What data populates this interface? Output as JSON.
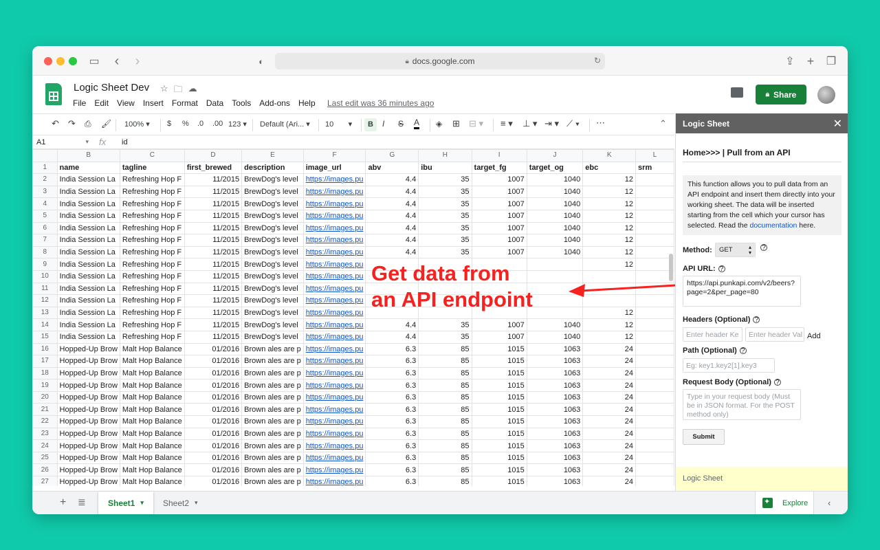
{
  "browser": {
    "url": "docs.google.com"
  },
  "doc": {
    "title": "Logic Sheet Dev",
    "menu": [
      "File",
      "Edit",
      "View",
      "Insert",
      "Format",
      "Data",
      "Tools",
      "Add-ons",
      "Help"
    ],
    "last_edit": "Last edit was 36 minutes ago",
    "share_label": "Share"
  },
  "toolbar": {
    "zoom": "100%",
    "currency": "$",
    "percent": "%",
    "dec_less": ".0",
    "dec_more": ".00",
    "number_format": "123",
    "font": "Default (Ari...",
    "font_size": "10",
    "bold": "B",
    "italic": "I",
    "strike": "S",
    "text_color": "A",
    "more": "⋯"
  },
  "formula_bar": {
    "cell_ref": "A1",
    "fx": "fx",
    "value": "id"
  },
  "grid": {
    "columns": [
      "B",
      "C",
      "D",
      "E",
      "F",
      "G",
      "H",
      "I",
      "J",
      "K",
      "L"
    ],
    "headers": [
      "name",
      "tagline",
      "first_brewed",
      "description",
      "image_url",
      "abv",
      "ibu",
      "target_fg",
      "target_og",
      "ebc",
      "srm"
    ],
    "rows": [
      [
        "2",
        "India Session La",
        "Refreshing Hop F",
        "11/2015",
        "BrewDog's level",
        "https://images.pu",
        "4.4",
        "35",
        "1007",
        "1040",
        "12",
        ""
      ],
      [
        "3",
        "India Session La",
        "Refreshing Hop F",
        "11/2015",
        "BrewDog's level",
        "https://images.pu",
        "4.4",
        "35",
        "1007",
        "1040",
        "12",
        ""
      ],
      [
        "4",
        "India Session La",
        "Refreshing Hop F",
        "11/2015",
        "BrewDog's level",
        "https://images.pu",
        "4.4",
        "35",
        "1007",
        "1040",
        "12",
        ""
      ],
      [
        "5",
        "India Session La",
        "Refreshing Hop F",
        "11/2015",
        "BrewDog's level",
        "https://images.pu",
        "4.4",
        "35",
        "1007",
        "1040",
        "12",
        ""
      ],
      [
        "6",
        "India Session La",
        "Refreshing Hop F",
        "11/2015",
        "BrewDog's level",
        "https://images.pu",
        "4.4",
        "35",
        "1007",
        "1040",
        "12",
        ""
      ],
      [
        "7",
        "India Session La",
        "Refreshing Hop F",
        "11/2015",
        "BrewDog's level",
        "https://images.pu",
        "4.4",
        "35",
        "1007",
        "1040",
        "12",
        ""
      ],
      [
        "8",
        "India Session La",
        "Refreshing Hop F",
        "11/2015",
        "BrewDog's level",
        "https://images.pu",
        "4.4",
        "35",
        "1007",
        "1040",
        "12",
        ""
      ],
      [
        "9",
        "India Session La",
        "Refreshing Hop F",
        "11/2015",
        "BrewDog's level",
        "https://images.pu",
        "",
        "",
        "",
        "",
        "12",
        ""
      ],
      [
        "10",
        "India Session La",
        "Refreshing Hop F",
        "11/2015",
        "BrewDog's level",
        "https://images.pu",
        "",
        "",
        "",
        "",
        "",
        ""
      ],
      [
        "11",
        "India Session La",
        "Refreshing Hop F",
        "11/2015",
        "BrewDog's level",
        "https://images.pu",
        "",
        "",
        "",
        "",
        "",
        ""
      ],
      [
        "12",
        "India Session La",
        "Refreshing Hop F",
        "11/2015",
        "BrewDog's level",
        "https://images.pu",
        "",
        "",
        "",
        "",
        "",
        ""
      ],
      [
        "13",
        "India Session La",
        "Refreshing Hop F",
        "11/2015",
        "BrewDog's level",
        "https://images.pu",
        "",
        "",
        "",
        "",
        "12",
        ""
      ],
      [
        "14",
        "India Session La",
        "Refreshing Hop F",
        "11/2015",
        "BrewDog's level",
        "https://images.pu",
        "4.4",
        "35",
        "1007",
        "1040",
        "12",
        ""
      ],
      [
        "15",
        "India Session La",
        "Refreshing Hop F",
        "11/2015",
        "BrewDog's level",
        "https://images.pu",
        "4.4",
        "35",
        "1007",
        "1040",
        "12",
        ""
      ],
      [
        "16",
        "Hopped-Up Brow",
        "Malt Hop Balance",
        "01/2016",
        "Brown ales are p",
        "https://images.pu",
        "6.3",
        "85",
        "1015",
        "1063",
        "24",
        ""
      ],
      [
        "17",
        "Hopped-Up Brow",
        "Malt Hop Balance",
        "01/2016",
        "Brown ales are p",
        "https://images.pu",
        "6.3",
        "85",
        "1015",
        "1063",
        "24",
        ""
      ],
      [
        "18",
        "Hopped-Up Brow",
        "Malt Hop Balance",
        "01/2016",
        "Brown ales are p",
        "https://images.pu",
        "6.3",
        "85",
        "1015",
        "1063",
        "24",
        ""
      ],
      [
        "19",
        "Hopped-Up Brow",
        "Malt Hop Balance",
        "01/2016",
        "Brown ales are p",
        "https://images.pu",
        "6.3",
        "85",
        "1015",
        "1063",
        "24",
        ""
      ],
      [
        "20",
        "Hopped-Up Brow",
        "Malt Hop Balance",
        "01/2016",
        "Brown ales are p",
        "https://images.pu",
        "6.3",
        "85",
        "1015",
        "1063",
        "24",
        ""
      ],
      [
        "21",
        "Hopped-Up Brow",
        "Malt Hop Balance",
        "01/2016",
        "Brown ales are p",
        "https://images.pu",
        "6.3",
        "85",
        "1015",
        "1063",
        "24",
        ""
      ],
      [
        "22",
        "Hopped-Up Brow",
        "Malt Hop Balance",
        "01/2016",
        "Brown ales are p",
        "https://images.pu",
        "6.3",
        "85",
        "1015",
        "1063",
        "24",
        ""
      ],
      [
        "23",
        "Hopped-Up Brow",
        "Malt Hop Balance",
        "01/2016",
        "Brown ales are p",
        "https://images.pu",
        "6.3",
        "85",
        "1015",
        "1063",
        "24",
        ""
      ],
      [
        "24",
        "Hopped-Up Brow",
        "Malt Hop Balance",
        "01/2016",
        "Brown ales are p",
        "https://images.pu",
        "6.3",
        "85",
        "1015",
        "1063",
        "24",
        ""
      ],
      [
        "25",
        "Hopped-Up Brow",
        "Malt Hop Balance",
        "01/2016",
        "Brown ales are p",
        "https://images.pu",
        "6.3",
        "85",
        "1015",
        "1063",
        "24",
        ""
      ],
      [
        "26",
        "Hopped-Up Brow",
        "Malt Hop Balance",
        "01/2016",
        "Brown ales are p",
        "https://images.pu",
        "6.3",
        "85",
        "1015",
        "1063",
        "24",
        ""
      ],
      [
        "27",
        "Hopped-Up Brow",
        "Malt Hop Balance",
        "01/2016",
        "Brown ales are p",
        "https://images.pu",
        "6.3",
        "85",
        "1015",
        "1063",
        "24",
        ""
      ]
    ]
  },
  "annotation": {
    "line1": "Get data from",
    "line2": "an API endpoint",
    "color": "#f5221f"
  },
  "sidebar": {
    "title": "Logic Sheet",
    "breadcrumb": "Home>>> | Pull from an API",
    "info_before_link": "This function allows you to pull data from an API endpoint and insert them directly into your working sheet. The data will be inserted starting from the cell which your cursor has selected. Read the ",
    "info_link": "documentation",
    "info_after_link": " here.",
    "method_label": "Method:",
    "method_value": "GET",
    "api_url_label": "API URL:",
    "api_url_value": "https://api.punkapi.com/v2/beers?page=2&per_page=80",
    "headers_label": "Headers (Optional)",
    "header_key_placeholder": "Enter header Ke",
    "header_value_placeholder": "Enter header Val",
    "add_label": "Add",
    "path_label": "Path (Optional)",
    "path_placeholder": "Eg: key1.key2[1].key3",
    "body_label": "Request Body (Optional)",
    "body_placeholder": "Type in your request body (Must be in JSON format. For the POST method only)",
    "submit_label": "Submit",
    "footer": "Logic Sheet"
  },
  "tabs": {
    "sheets": [
      "Sheet1",
      "Sheet2"
    ],
    "explore_label": "Explore"
  },
  "colors": {
    "share_green": "#188038",
    "sidebar_header": "#616161",
    "footer_yellow": "#ffffcc",
    "link_blue": "#1155cc"
  }
}
